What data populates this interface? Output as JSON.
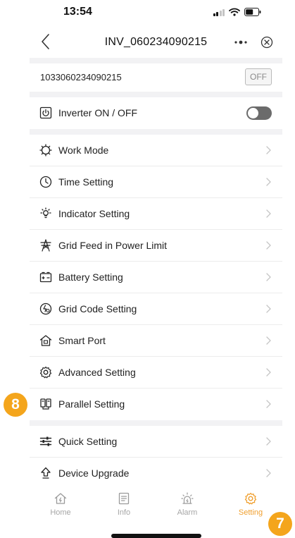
{
  "status_bar": {
    "time": "13:54"
  },
  "nav": {
    "title": "INV_060234090215"
  },
  "device": {
    "serial": "1033060234090215",
    "off_badge": "OFF"
  },
  "inverter_toggle": {
    "label": "Inverter ON / OFF",
    "state": "off"
  },
  "menu": {
    "items": [
      {
        "label": "Work Mode",
        "icon": "work-mode-icon"
      },
      {
        "label": "Time Setting",
        "icon": "clock-icon"
      },
      {
        "label": "Indicator Setting",
        "icon": "indicator-icon"
      },
      {
        "label": "Grid Feed in Power Limit",
        "icon": "grid-tower-icon"
      },
      {
        "label": "Battery Setting",
        "icon": "battery-icon"
      },
      {
        "label": "Grid Code Setting",
        "icon": "grid-code-icon"
      },
      {
        "label": "Smart Port",
        "icon": "smart-port-icon"
      },
      {
        "label": "Advanced Setting",
        "icon": "gear-icon"
      },
      {
        "label": "Parallel Setting",
        "icon": "parallel-icon"
      }
    ],
    "items2": [
      {
        "label": "Quick Setting",
        "icon": "sliders-icon"
      },
      {
        "label": "Device Upgrade",
        "icon": "upgrade-icon"
      }
    ]
  },
  "tabbar": {
    "tabs": [
      {
        "label": "Home",
        "icon": "home-icon"
      },
      {
        "label": "Info",
        "icon": "document-icon"
      },
      {
        "label": "Alarm",
        "icon": "alarm-icon"
      },
      {
        "label": "Setting",
        "icon": "gear-icon"
      }
    ],
    "active": "Setting"
  },
  "annotations": {
    "badge_parallel": "8",
    "badge_setting": "7"
  },
  "colors": {
    "accent": "#f0a030",
    "badge": "#f4a51c",
    "toggle_off": "#6b6b6b"
  }
}
